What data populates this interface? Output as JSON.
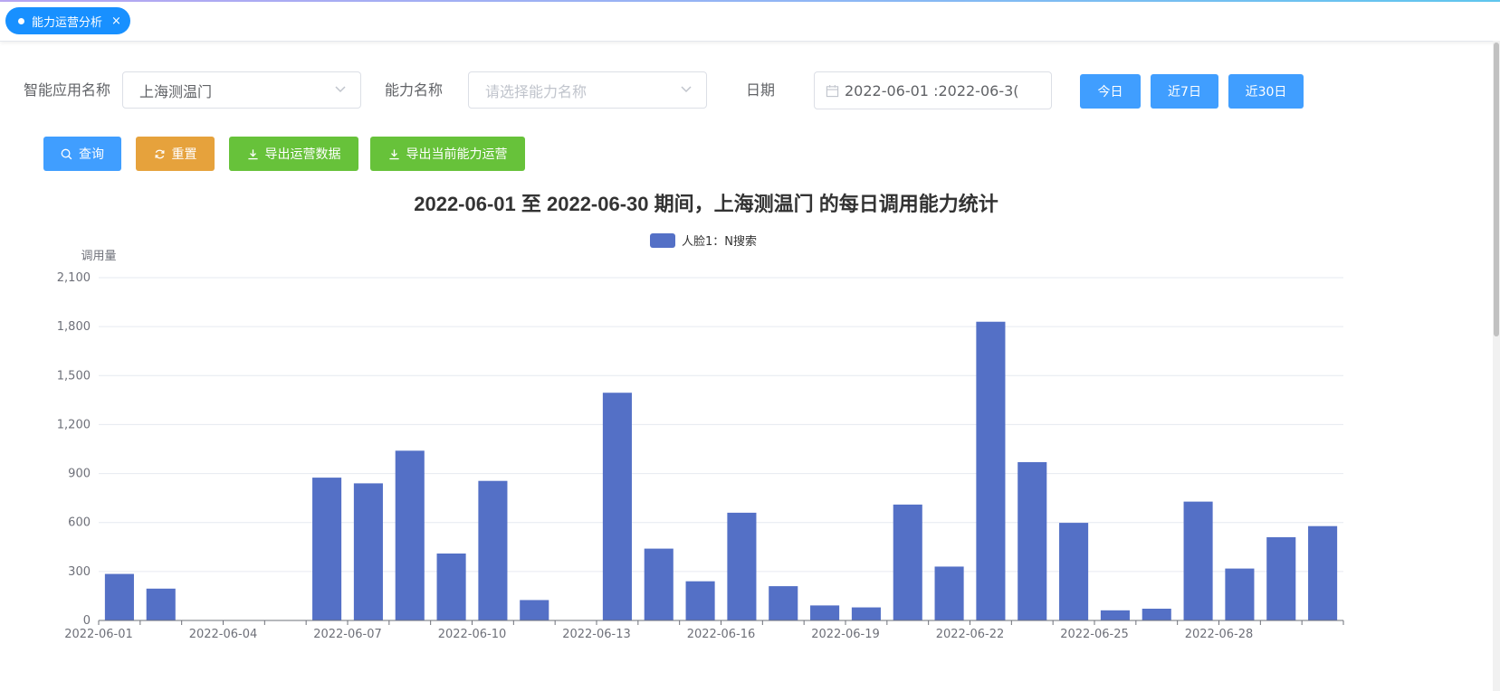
{
  "tab": {
    "label": "能力运营分析",
    "close": "×"
  },
  "filters": {
    "app_label": "智能应用名称",
    "app_value": "上海测温门",
    "ability_label": "能力名称",
    "ability_placeholder": "请选择能力名称",
    "date_label": "日期",
    "date_value": "2022-06-01 :2022-06-3("
  },
  "quick_buttons": {
    "today": "今日",
    "last7": "近7日",
    "last30": "近30日"
  },
  "actions": {
    "query": "查询",
    "reset": "重置",
    "export_ops": "导出运营数据",
    "export_current": "导出当前能力运营"
  },
  "colors": {
    "bar": "#5470c6",
    "primary": "#409eff",
    "warning": "#e6a23c",
    "success": "#67c23a"
  },
  "chart_data": {
    "type": "bar",
    "title": "2022-06-01 至 2022-06-30 期间，上海测温门 的每日调用能力统计",
    "ylabel": "调用量",
    "ylim": [
      0,
      2100
    ],
    "yticks": [
      "0",
      "300",
      "600",
      "900",
      "1,200",
      "1,500",
      "1,800",
      "2,100"
    ],
    "legend_position": "top-center",
    "grid": true,
    "categories": [
      "2022-06-01",
      "2022-06-02",
      "2022-06-03",
      "2022-06-04",
      "2022-06-05",
      "2022-06-06",
      "2022-06-07",
      "2022-06-08",
      "2022-06-09",
      "2022-06-10",
      "2022-06-11",
      "2022-06-12",
      "2022-06-13",
      "2022-06-14",
      "2022-06-15",
      "2022-06-16",
      "2022-06-17",
      "2022-06-18",
      "2022-06-19",
      "2022-06-20",
      "2022-06-21",
      "2022-06-22",
      "2022-06-23",
      "2022-06-24",
      "2022-06-25",
      "2022-06-26",
      "2022-06-27",
      "2022-06-28",
      "2022-06-29",
      "2022-06-30"
    ],
    "xtick_labels": [
      "2022-06-01",
      "2022-06-04",
      "2022-06-07",
      "2022-06-10",
      "2022-06-13",
      "2022-06-16",
      "2022-06-19",
      "2022-06-22",
      "2022-06-25",
      "2022-06-28"
    ],
    "series": [
      {
        "name": "人脸1：N搜索",
        "values": [
          285,
          195,
          0,
          0,
          0,
          875,
          840,
          1040,
          410,
          855,
          125,
          0,
          1395,
          440,
          240,
          660,
          210,
          92,
          80,
          710,
          330,
          1830,
          970,
          598,
          62,
          72,
          728,
          318,
          510,
          578
        ]
      }
    ]
  }
}
